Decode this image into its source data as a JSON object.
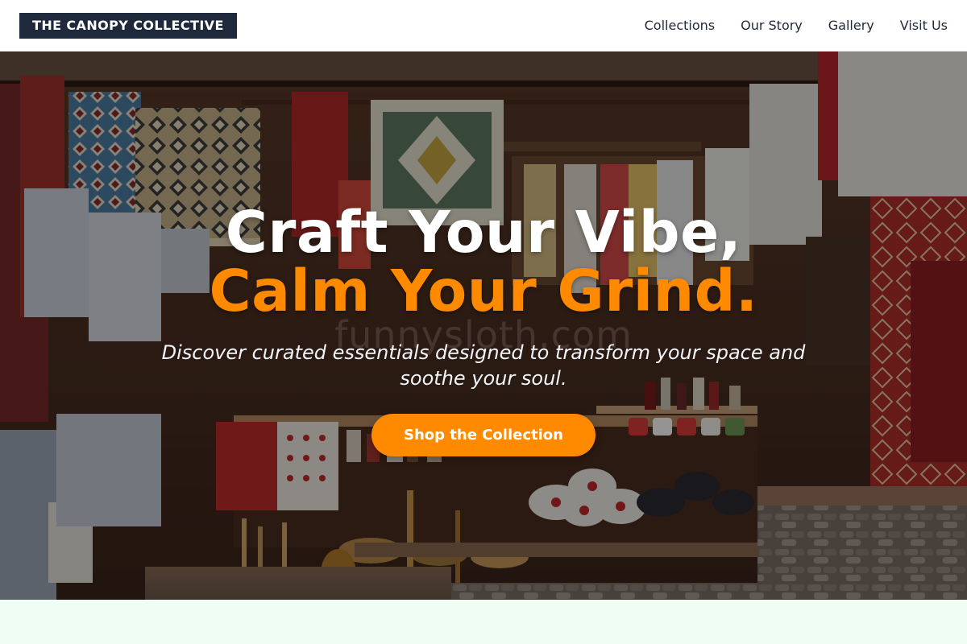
{
  "header": {
    "logo": "THE CANOPY COLLECTIVE",
    "nav": [
      {
        "label": "Collections"
      },
      {
        "label": "Our Story"
      },
      {
        "label": "Gallery"
      },
      {
        "label": "Visit Us"
      }
    ]
  },
  "hero": {
    "headline_line1": "Craft Your Vibe,",
    "headline_line2": "Calm Your Grind.",
    "subtitle": "Discover curated essentials designed to transform your space and soothe your soul.",
    "cta_label": "Shop the Collection",
    "watermark": "funnysloth.com",
    "background": "market-stall-photo"
  },
  "colors": {
    "accent": "#ff8a00",
    "logo_bg": "#1e293b",
    "next_section_bg": "#f0fdf4"
  }
}
